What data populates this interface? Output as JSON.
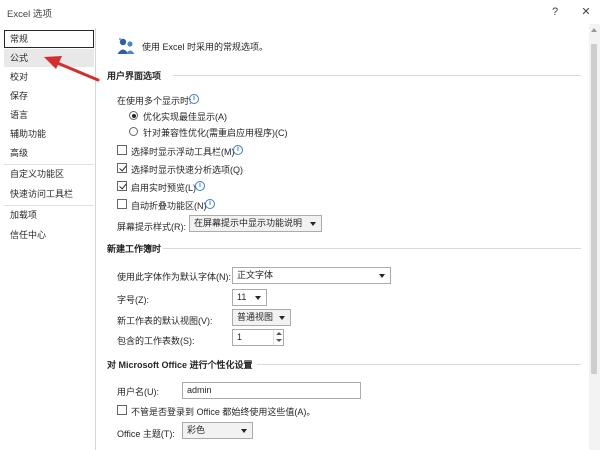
{
  "window": {
    "title": "Excel 选项",
    "help": "?",
    "close": "✕"
  },
  "sidebar": {
    "items": [
      {
        "label": "常规"
      },
      {
        "label": "公式"
      },
      {
        "label": "校对"
      },
      {
        "label": "保存"
      },
      {
        "label": "语言"
      },
      {
        "label": "辅助功能"
      },
      {
        "label": "高级"
      },
      {
        "label": "自定义功能区"
      },
      {
        "label": "快速访问工具栏"
      },
      {
        "label": "加载项"
      },
      {
        "label": "信任中心"
      }
    ]
  },
  "main": {
    "header": "使用 Excel 时采用的常规选项。",
    "ui_section": {
      "title": "用户界面选项",
      "multi_display_label": "在使用多个显示时:",
      "radio_optimize": "优化实现最佳显示(A)",
      "radio_compat": "针对兼容性优化(需重启应用程序)(C)",
      "chk_mini_toolbar": "选择时显示浮动工具栏(M)",
      "chk_quick_analysis": "选择时显示快速分析选项(Q)",
      "chk_live_preview": "启用实时预览(L)",
      "chk_collapse_ribbon": "自动折叠功能区(N)",
      "tooltip_style_label": "屏幕提示样式(R):",
      "tooltip_style_value": "在屏幕提示中显示功能说明"
    },
    "workbook_section": {
      "title": "新建工作簿时",
      "font_label": "使用此字体作为默认字体(N):",
      "font_value": "正文字体",
      "size_label": "字号(Z):",
      "size_value": "11",
      "view_label": "新工作表的默认视图(V):",
      "view_value": "普通视图",
      "sheets_label": "包含的工作表数(S):",
      "sheets_value": "1"
    },
    "personalize_section": {
      "title": "对 Microsoft Office 进行个性化设置",
      "username_label": "用户名(U):",
      "username_value": "admin",
      "chk_always_use": "不管是否登录到 Office 都始终使用这些值(A)。",
      "theme_label": "Office 主题(T):",
      "theme_value": "彩色"
    }
  },
  "colors": {
    "annotation_arrow": "#d32f2f",
    "info_icon": "#3c7dc4"
  }
}
